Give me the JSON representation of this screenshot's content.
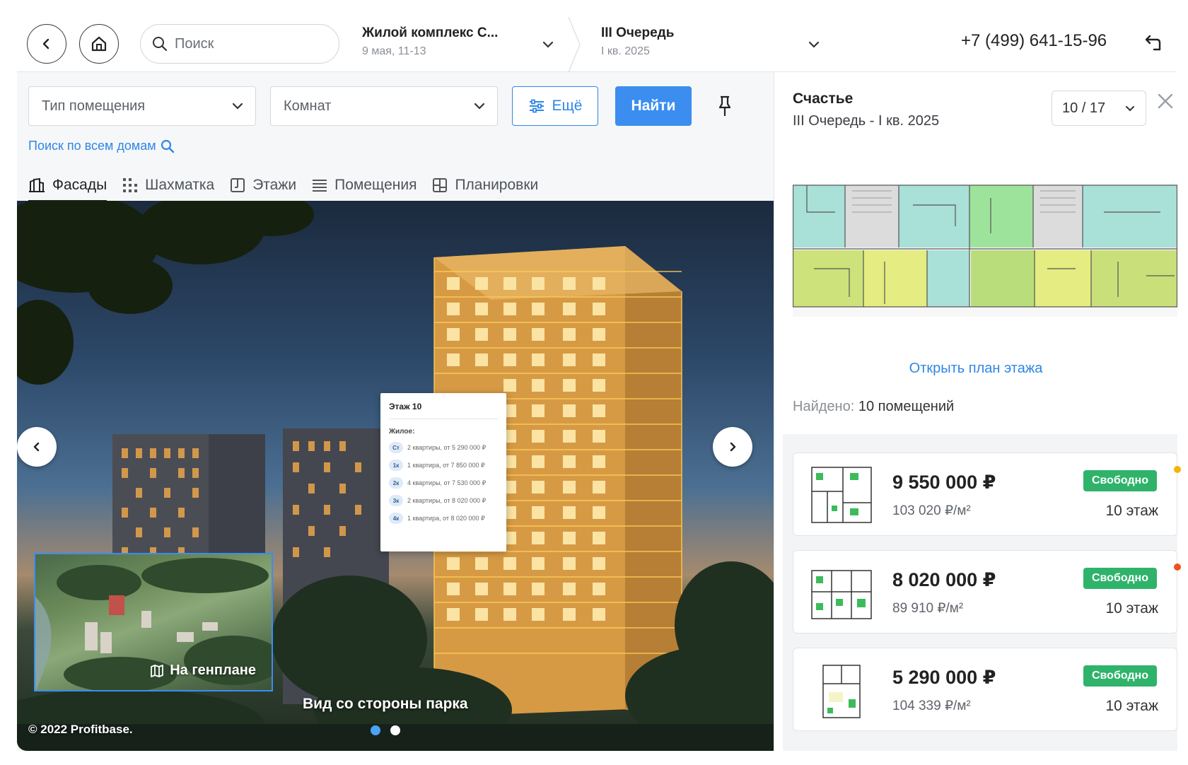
{
  "header": {
    "search_placeholder": "Поиск",
    "complex": {
      "title": "Жилой комплекс С...",
      "subtitle": "9 мая, 11-13"
    },
    "queue": {
      "title": "III Очередь",
      "subtitle": "I кв. 2025"
    },
    "phone": "+7 (499) 641-15-96"
  },
  "filters": {
    "type_label": "Тип помещения",
    "rooms_label": "Комнат",
    "more_label": "Ещё",
    "find_label": "Найти",
    "all_houses_link": "Поиск по всем домам"
  },
  "tabs": [
    {
      "label": "Фасады",
      "icon": "building-icon",
      "active": true
    },
    {
      "label": "Шахматка",
      "icon": "grid-dots-icon",
      "active": false
    },
    {
      "label": "Этажи",
      "icon": "floors-icon",
      "active": false
    },
    {
      "label": "Помещения",
      "icon": "list-icon",
      "active": false
    },
    {
      "label": "Планировки",
      "icon": "layout-icon",
      "active": false
    }
  ],
  "facade": {
    "popup": {
      "title": "Этаж 10",
      "section": "Жилое:",
      "rows": [
        {
          "badge": "Ст",
          "text": "2 квартиры, от 5 290 000 ₽"
        },
        {
          "badge": "1к",
          "text": "1 квартира, от 7 850 000 ₽"
        },
        {
          "badge": "2к",
          "text": "4 квартиры, от 7 530 000 ₽"
        },
        {
          "badge": "3к",
          "text": "2 квартиры, от 8 020 000 ₽"
        },
        {
          "badge": "4к",
          "text": "1 квартира, от 8 020 000 ₽"
        }
      ]
    },
    "genplan_label": "На генплане",
    "caption": "Вид со стороны парка",
    "copyright": "© 2022 Profitbase.",
    "slides_total": 2,
    "slide_active": 1
  },
  "side": {
    "title": "Счастье",
    "subtitle": "III Очередь - I кв. 2025",
    "floor_selector": "10 / 17",
    "open_plan_link": "Открыть план этажа",
    "found_label": "Найдено:",
    "found_value": "10 помещений",
    "listings": [
      {
        "price": "9 550 000 ₽",
        "price_per_m2": "103 020 ₽/м²",
        "status": "Свободно",
        "floor": "10 этаж",
        "mark_color": "#f5b400"
      },
      {
        "price": "8 020 000 ₽",
        "price_per_m2": "89 910 ₽/м²",
        "status": "Свободно",
        "floor": "10 этаж",
        "mark_color": "#f0521e"
      },
      {
        "price": "5 290 000 ₽",
        "price_per_m2": "104 339 ₽/м²",
        "status": "Свободно",
        "floor": "10 этаж",
        "mark_color": ""
      }
    ]
  },
  "colors": {
    "accent": "#3b8ef0",
    "status_free": "#2fb36b",
    "plan_teal": "#a9e0d8",
    "plan_green": "#9ee39b",
    "plan_yellow": "#e4ec82"
  }
}
